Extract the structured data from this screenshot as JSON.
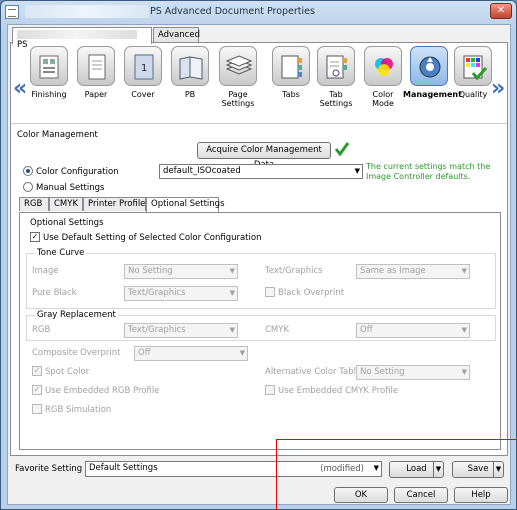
{
  "window": {
    "title": "PS Advanced Document Properties",
    "close_label": "✕"
  },
  "top_tabs": [
    {
      "label": "PS"
    },
    {
      "label": "Advanced"
    }
  ],
  "nav": {
    "left_arrow": "«",
    "right_arrow": "»"
  },
  "categories": [
    {
      "label": "Finishing",
      "icon": "finishing-icon"
    },
    {
      "label": "Paper",
      "icon": "paper-icon"
    },
    {
      "label": "Cover",
      "icon": "cover-icon"
    },
    {
      "label": "PB",
      "icon": "perfect-binding-icon"
    },
    {
      "label": "Page Settings",
      "icon": "page-settings-icon"
    },
    {
      "label": "Tabs",
      "icon": "tabs-icon"
    },
    {
      "label": "Tab Settings",
      "icon": "tab-settings-icon"
    },
    {
      "label": "Color Mode",
      "label_line1": "Color",
      "label_line2": "Mode",
      "icon": "color-mode-icon"
    },
    {
      "label": "Management",
      "icon": "color-management-icon",
      "active": true
    },
    {
      "label": "Quality",
      "icon": "quality-icon"
    }
  ],
  "color_management": {
    "section_title": "Color Management",
    "acquire_button": "Acquire Color Management Data",
    "status_note_line1": "The current settings match the",
    "status_note_line2": "Image Controller defaults.",
    "color_configuration_label": "Color Configuration",
    "color_configuration_value": "default_ISOcoated",
    "manual_settings_label": "Manual Settings",
    "selected_radio": "Color Configuration"
  },
  "sub_tabs": [
    {
      "label": "RGB"
    },
    {
      "label": "CMYK"
    },
    {
      "label": "Printer Profile"
    },
    {
      "label": "Optional Settings",
      "active": true
    }
  ],
  "optional": {
    "title": "Optional Settings",
    "use_default_label": "Use Default Setting of Selected Color Configuration",
    "use_default_checked": true,
    "tone_curve": {
      "title": "Tone Curve",
      "image_label": "Image",
      "image_value": "No Setting",
      "text_graphics_label": "Text/Graphics",
      "text_graphics_value": "Same as Image",
      "pure_black_label": "Pure Black",
      "pure_black_value": "Text/Graphics",
      "black_overprint_label": "Black Overprint"
    },
    "gray_replacement": {
      "title": "Gray Replacement",
      "rgb_label": "RGB",
      "rgb_value": "Text/Graphics",
      "cmyk_label": "CMYK",
      "cmyk_value": "Off"
    },
    "composite_overprint_label": "Composite Overprint",
    "composite_overprint_value": "Off",
    "spot_color_label": "Spot Color",
    "alt_color_table_label": "Alternative Color Table",
    "alt_color_table_value": "No Setting",
    "embedded_rgb_label": "Use Embedded RGB Profile",
    "embedded_cmyk_label": "Use Embedded CMYK Profile",
    "rgb_simulation_label": "RGB Simulation"
  },
  "favorite": {
    "label": "Favorite Setting",
    "value": "Default Settings",
    "state": "(modified)",
    "load_label": "Load",
    "save_label": "Save"
  },
  "dialog_buttons": {
    "ok": "OK",
    "cancel": "Cancel",
    "help": "Help"
  },
  "colors": {
    "accent": "#3b6fb6",
    "note_green": "#2a9a2a",
    "annotation_red": "#e00000"
  }
}
